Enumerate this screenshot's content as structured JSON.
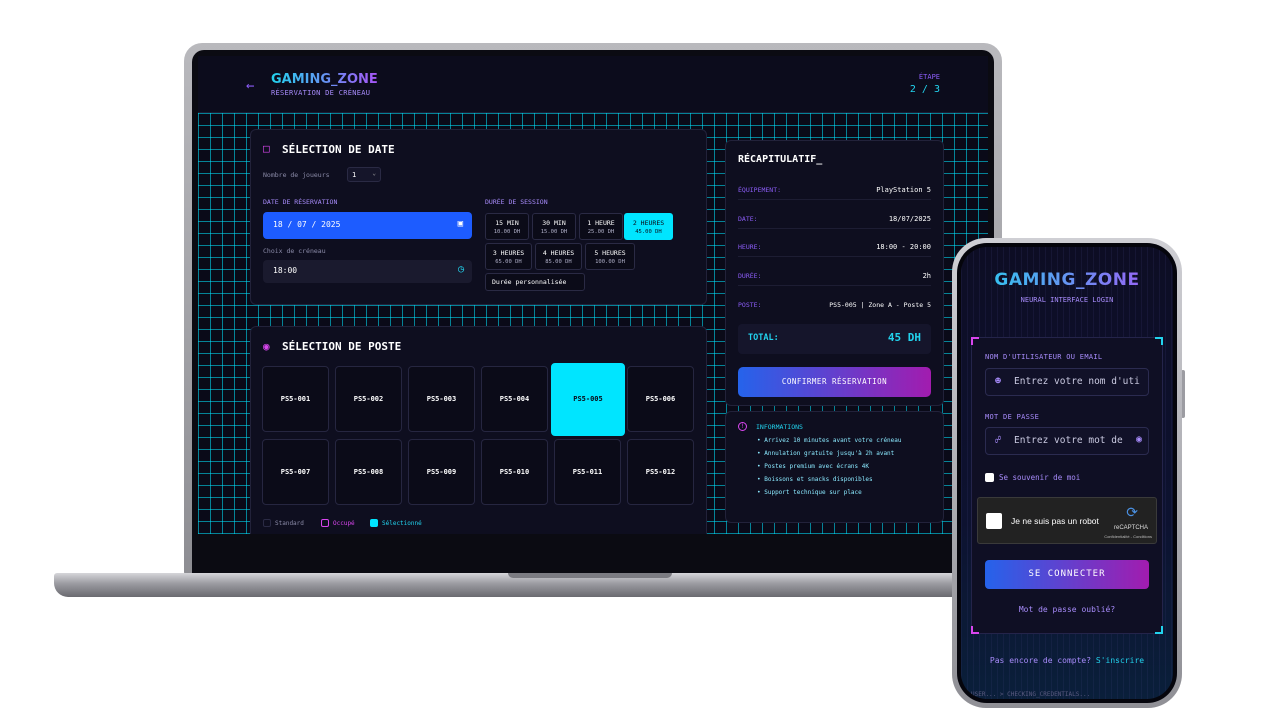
{
  "laptop": {
    "back_icon": "arrow-left-icon",
    "brand": "GAMING_ZONE",
    "subtitle": "RÉSERVATION DE CRÉNEAU",
    "step_label": "ÉTAPE",
    "step_value": "2 / 3",
    "date_panel": {
      "title": "SÉLECTION DE DATE",
      "icon": "calendar-icon",
      "players_label": "Nombre de joueurs",
      "players_value": "1",
      "date_label": "DATE DE RÉSERVATION",
      "date_value": "18 / 07 / 2025",
      "slot_label": "Choix de créneau",
      "slot_value": "18:00",
      "duration_label": "DURÉE DE SESSION",
      "durations": [
        {
          "label": "15 MIN",
          "price": "10.00 DH"
        },
        {
          "label": "30 MIN",
          "price": "15.00 DH"
        },
        {
          "label": "1 HEURE",
          "price": "25.00 DH"
        },
        {
          "label": "2 HEURES",
          "price": "45.00 DH",
          "selected": true
        },
        {
          "label": "3 HEURES",
          "price": "65.00 DH"
        },
        {
          "label": "4 HEURES",
          "price": "85.00 DH"
        },
        {
          "label": "5 HEURES",
          "price": "100.00 DH"
        }
      ],
      "custom_duration": "Durée personnalisée"
    },
    "station_panel": {
      "title": "SÉLECTION DE POSTE",
      "icon": "location-pin-icon",
      "stations": [
        "PS5-001",
        "PS5-002",
        "PS5-003",
        "PS5-004",
        "PS5-005",
        "PS5-006",
        "PS5-007",
        "PS5-008",
        "PS5-009",
        "PS5-010",
        "PS5-011",
        "PS5-012"
      ],
      "selected_station": "PS5-005",
      "legend": [
        "Standard",
        "Occupé",
        "Sélectionné"
      ],
      "colors": {
        "accent": "#00e5ff",
        "occupied": "#d946ef",
        "standard": "#2a2a44"
      }
    },
    "summary": {
      "title": "RÉCAPITULATIF_",
      "rows": [
        {
          "key": "ÉQUIPEMENT:",
          "value": "PlayStation 5"
        },
        {
          "key": "DATE:",
          "value": "18/07/2025"
        },
        {
          "key": "HEURE:",
          "value": "18:00 - 20:00"
        },
        {
          "key": "DURÉE:",
          "value": "2h"
        },
        {
          "key": "POSTE:",
          "value": "PS5-005 | Zone A - Poste 5"
        }
      ],
      "total_label": "TOTAL:",
      "total_value": "45 DH",
      "confirm": "CONFIRMER RÉSERVATION"
    },
    "info": {
      "title": "INFORMATIONS",
      "icon": "info-icon",
      "items": [
        "Arrivez 10 minutes avant votre créneau",
        "Annulation gratuite jusqu'à 2h avant",
        "Postes premium avec écrans 4K",
        "Boissons et snacks disponibles",
        "Support technique sur place"
      ]
    }
  },
  "phone": {
    "brand": "GAMING_ZONE",
    "subtitle": "NEURAL INTERFACE LOGIN",
    "username_label": "NOM D'UTILISATEUR OU EMAIL",
    "username_placeholder": "Entrez votre nom d'uti",
    "password_label": "MOT DE PASSE",
    "password_placeholder": "Entrez votre mot de",
    "remember": "Se souvenir de moi",
    "captcha_text": "Je ne suis pas un robot",
    "captcha_brand": "reCAPTCHA",
    "captcha_links": "Confidentialité - Conditions",
    "login_button": "SE CONNECTER",
    "forgot": "Mot de passe oublié?",
    "signup_prompt": "Pas encore de compte?",
    "signup_link": "S'inscrire",
    "terminal": "USER... > CHECKING_CREDENTIALS..."
  }
}
